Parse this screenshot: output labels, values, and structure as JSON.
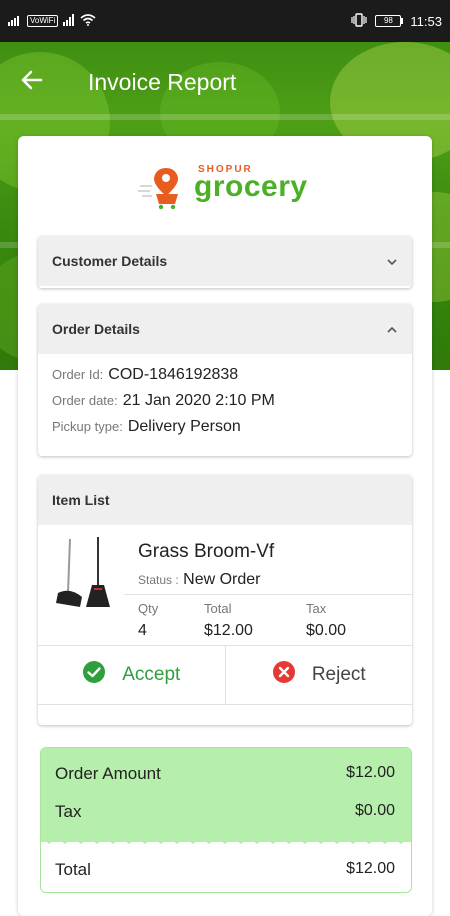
{
  "status_bar": {
    "network_label": "VoWiFi",
    "battery": "98",
    "time": "11:53",
    "icons": [
      "signal-icon",
      "wifi-icon",
      "vibrate-icon",
      "battery-icon"
    ]
  },
  "app_bar": {
    "title": "Invoice Report",
    "back_icon": "arrow-left-icon"
  },
  "logo": {
    "top_text": "SHOPUR",
    "word": "grocery"
  },
  "customer_details": {
    "title": "Customer Details",
    "expanded": false
  },
  "order_details": {
    "title": "Order Details",
    "expanded": true,
    "order_id_label": "Order Id:",
    "order_id": "COD-1846192838",
    "order_date_label": "Order date:",
    "order_date": "21 Jan 2020 2:10 PM",
    "pickup_type_label": "Pickup type:",
    "pickup_type": "Delivery Person"
  },
  "item_list": {
    "title": "Item List",
    "items": [
      {
        "name": "Grass Broom-Vf",
        "status_label": "Status :",
        "status": "New Order",
        "qty_label": "Qty",
        "qty": "4",
        "total_label": "Total",
        "total": "$12.00",
        "tax_label": "Tax",
        "tax": "$0.00"
      }
    ],
    "accept_label": "Accept",
    "reject_label": "Reject"
  },
  "summary": {
    "order_amount_label": "Order Amount",
    "order_amount": "$12.00",
    "tax_label": "Tax",
    "tax": "$0.00",
    "total_label": "Total",
    "total": "$12.00"
  },
  "colors": {
    "brand_green": "#4caf28",
    "brand_orange": "#e85d1f",
    "accept_green": "#2e9e3e",
    "reject_red": "#e53935",
    "summary_bg": "#b6efab"
  }
}
